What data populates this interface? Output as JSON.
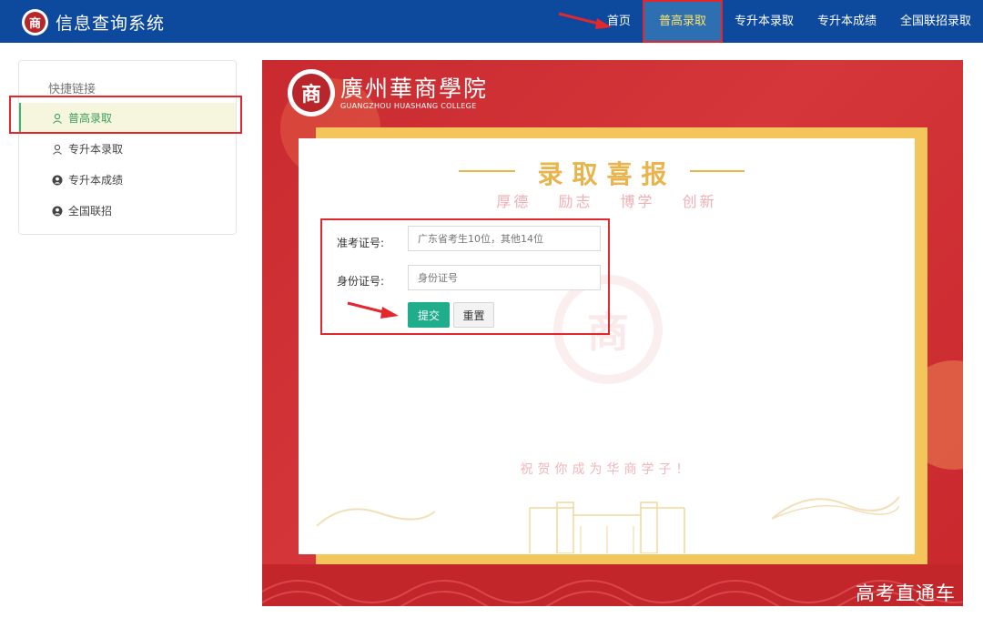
{
  "app": {
    "logo_char": "商",
    "title": "信息查询系统"
  },
  "nav": {
    "items": [
      {
        "label": "首页"
      },
      {
        "label": "普高录取"
      },
      {
        "label": "专升本录取"
      },
      {
        "label": "专升本成绩"
      },
      {
        "label": "全国联招录取"
      }
    ],
    "active_index": 1
  },
  "sidebar": {
    "heading": "快捷链接",
    "items": [
      {
        "label": "普高录取",
        "icon": "user-outline-icon"
      },
      {
        "label": "专升本录取",
        "icon": "user-outline-icon"
      },
      {
        "label": "专升本成绩",
        "icon": "user-circle-icon"
      },
      {
        "label": "全国联招",
        "icon": "user-circle-icon"
      }
    ],
    "active_index": 0
  },
  "college": {
    "logo_char": "商",
    "name_cn": "廣州華商學院",
    "name_en": "GUANGZHOU HUASHANG COLLEGE"
  },
  "banner": {
    "title": "录取喜报",
    "motto": "厚德 励志 博学 创新",
    "blessing": "祝贺你成为华商学子！"
  },
  "form": {
    "exam_label": "准考证号:",
    "exam_placeholder": "广东省考生10位，其他14位",
    "id_label": "身份证号:",
    "id_placeholder": "身份证号",
    "submit_label": "提交",
    "reset_label": "重置"
  },
  "watermark_text": "高考直通车",
  "colors": {
    "topbar": "#0d4a9e",
    "nav_active_bg": "#2d6fb0",
    "nav_active_text": "#ffe36b",
    "highlight_red": "#e3272d",
    "poster_red": "#c92a2f",
    "gold": "#f4c55b",
    "submit_green": "#1fad8b",
    "sidebar_active": "#3d9f5a"
  }
}
